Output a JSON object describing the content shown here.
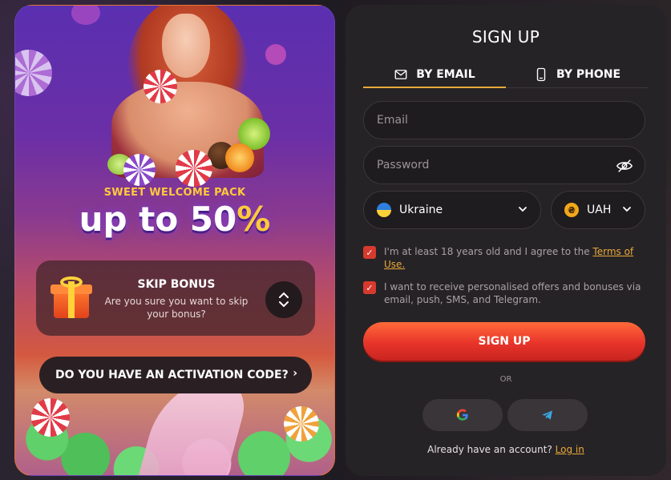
{
  "promo": {
    "subtitle": "SWEET WELCOME PACK",
    "headline_main": "up to 50",
    "headline_pct": "%",
    "skip": {
      "title": "SKIP BONUS",
      "description": "Are you sure you want to skip your bonus?"
    },
    "activation_code_label": "DO YOU HAVE AN ACTIVATION CODE?"
  },
  "signup": {
    "title": "SIGN UP",
    "tabs": [
      {
        "label": "BY EMAIL",
        "icon": "envelope-icon",
        "active": true
      },
      {
        "label": "BY PHONE",
        "icon": "phone-icon",
        "active": false
      }
    ],
    "email_placeholder": "Email",
    "password_placeholder": "Password",
    "country": {
      "value": "Ukraine",
      "icon": "ukraine-flag-icon"
    },
    "currency": {
      "value": "UAH",
      "icon": "hryvnia-coin-icon",
      "symbol": "₴"
    },
    "checkboxes": [
      {
        "text": "I'm at least 18 years old and I agree to the ",
        "link": "Terms of Use.",
        "checked": true
      },
      {
        "text": "I want to receive personalised offers and bonuses via email, push, SMS, and Telegram.",
        "checked": true
      }
    ],
    "submit_label": "SIGN UP",
    "or_label": "OR",
    "social": [
      {
        "name": "google",
        "icon": "google-icon"
      },
      {
        "name": "telegram",
        "icon": "telegram-icon"
      }
    ],
    "login_prompt": "Already have an account?",
    "login_link": "Log in"
  },
  "colors": {
    "accent": "#e8a93a",
    "primary_button": "#e8342a",
    "panel_bg": "#262326",
    "checkbox": "#d63a2e"
  }
}
